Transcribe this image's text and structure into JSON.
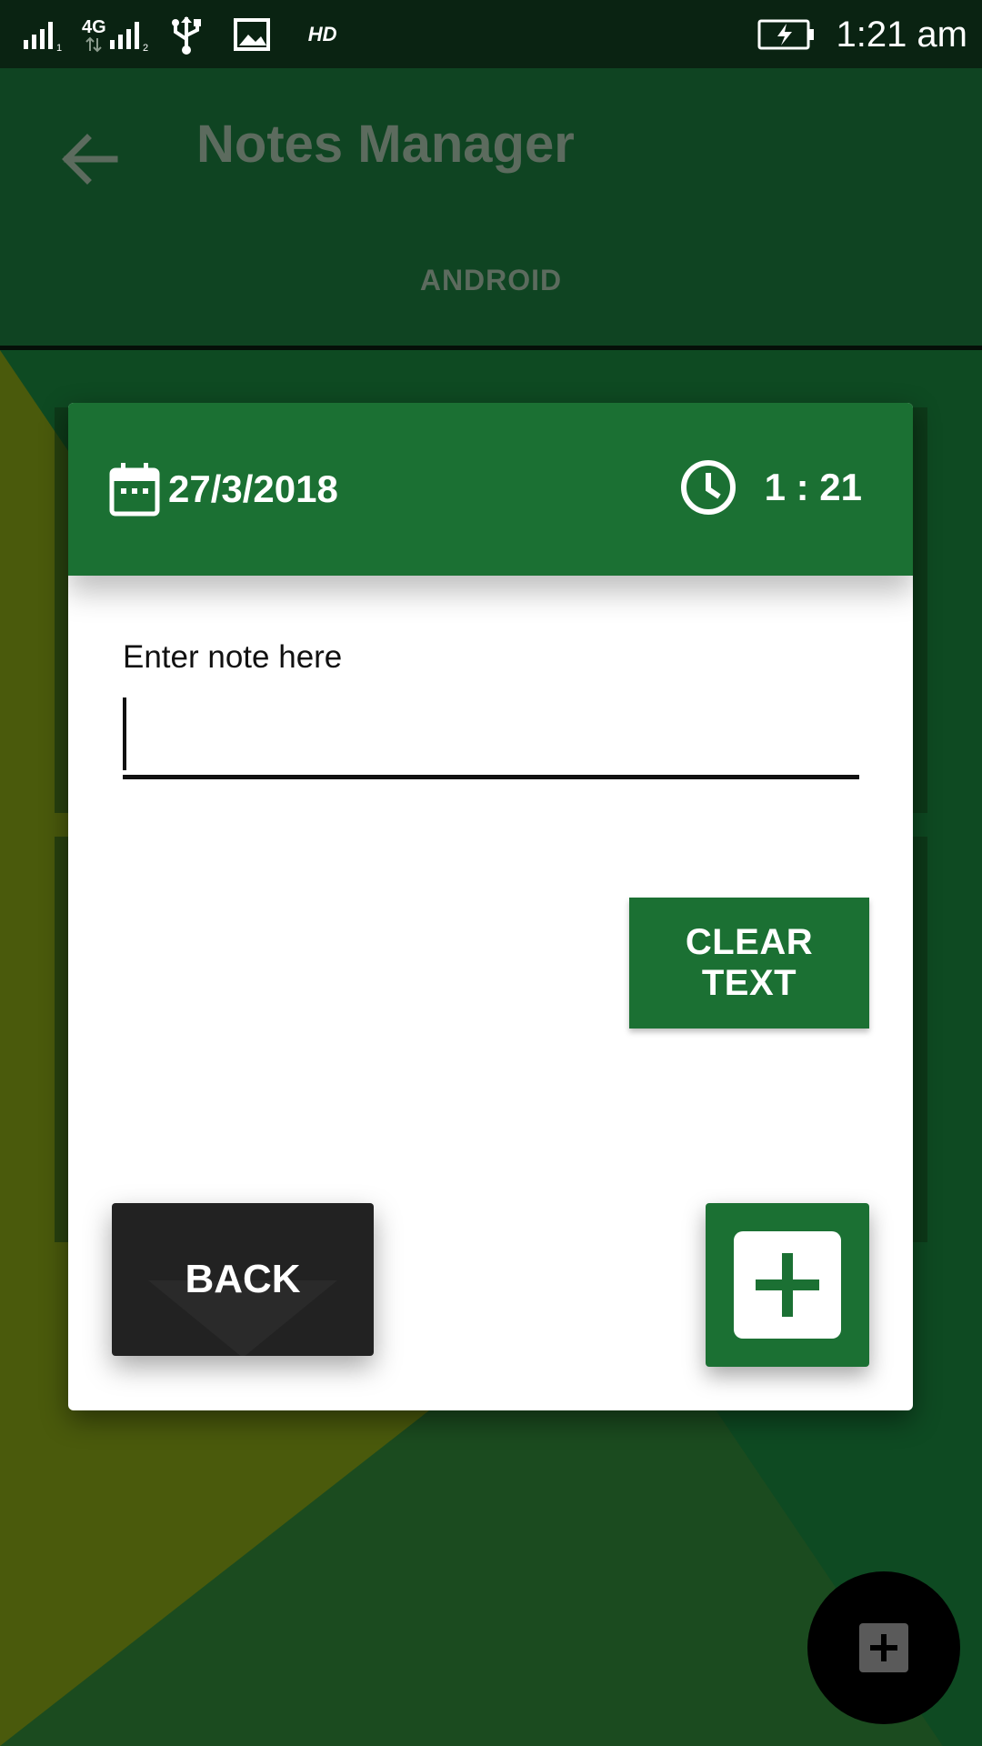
{
  "status_bar": {
    "network_label": "4G",
    "hd_label": "HD",
    "time": "1:21 am"
  },
  "app_bar": {
    "title": "Notes Manager",
    "tab_label": "ANDROID"
  },
  "dialog": {
    "date": "27/3/2018",
    "time": "1 : 21",
    "note_label": "Enter note here",
    "note_value": "",
    "clear_label": "CLEAR TEXT",
    "back_label": "BACK"
  },
  "colors": {
    "primary_green": "#1b7033",
    "app_bar": "#0f4422",
    "status_bar": "#0a2312",
    "olive_bg": "#4a5a0c",
    "dark_button": "#222222"
  },
  "icons": {
    "status": [
      "signal-icon",
      "signal-icon",
      "usb-icon",
      "image-icon",
      "battery-charging-icon"
    ],
    "app_bar": "back-arrow-icon",
    "dialog_date": "calendar-icon",
    "dialog_time": "clock-icon",
    "add": "plus-icon",
    "fab": "plus-icon"
  }
}
